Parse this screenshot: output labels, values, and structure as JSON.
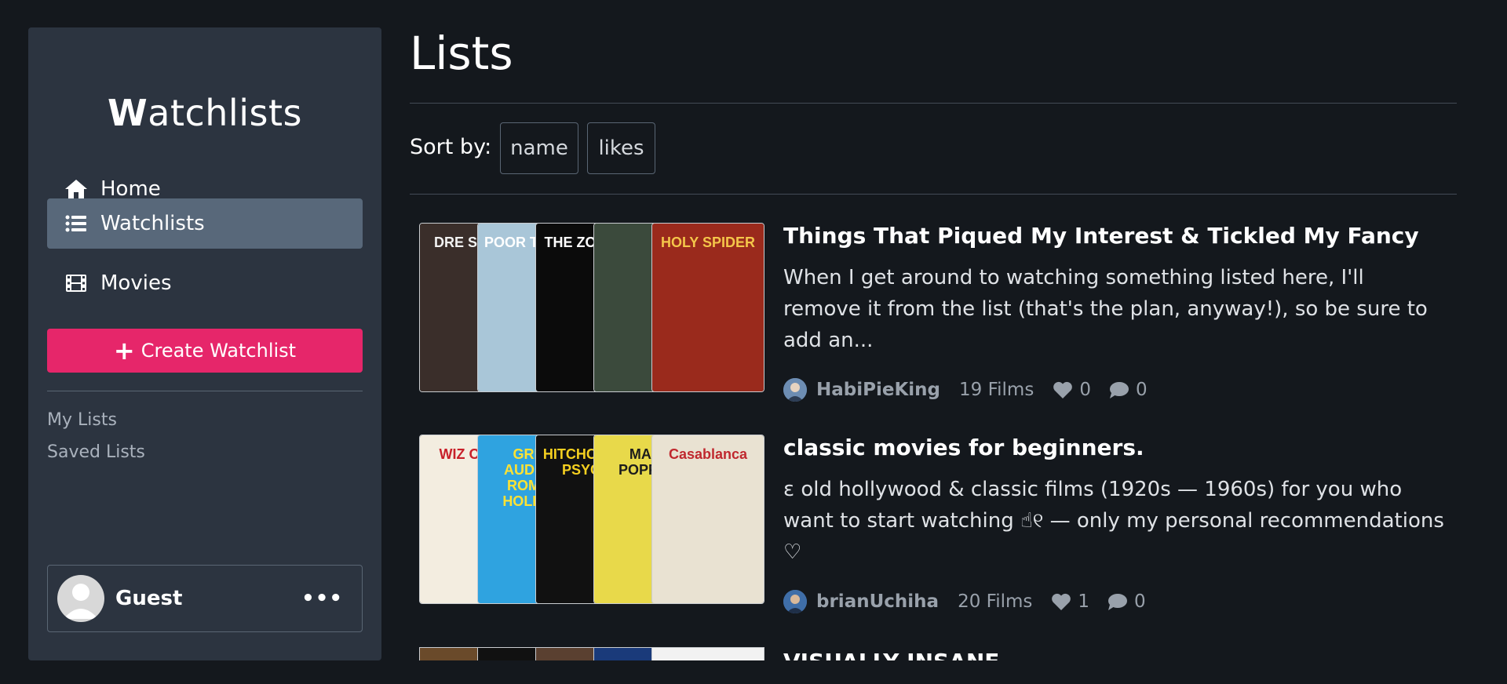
{
  "sidebar": {
    "brand_bold": "W",
    "brand_rest": "atchlists",
    "nav": [
      {
        "label": "Home",
        "icon": "home-icon"
      },
      {
        "label": "Watchlists",
        "icon": "list-icon"
      },
      {
        "label": "Movies",
        "icon": "film-icon"
      }
    ],
    "create_label": "Create Watchlist",
    "links": [
      "My Lists",
      "Saved Lists"
    ],
    "user": {
      "name": "Guest",
      "more": "•••"
    }
  },
  "main": {
    "title": "Lists",
    "sort_label": "Sort by:",
    "sort_options": [
      "name",
      "likes"
    ],
    "lists": [
      {
        "title": "Things That Piqued My Interest & Tickled My Fancy",
        "description": "When I get around to watching something listed here, I'll remove it from the list (that's the plan, anyway!), so be sure to add an...",
        "owner": "HabiPieKing",
        "films": "19 Films",
        "likes": "0",
        "comments": "0",
        "posters": [
          {
            "text": "DRE SCENA",
            "bg": "#3a2e2a",
            "fg": "#f2f2f2"
          },
          {
            "text": "POOR THINGS",
            "bg": "#a9c6d8",
            "fg": "#ffffff"
          },
          {
            "text": "THE ZONE OF",
            "bg": "#0b0b0b",
            "fg": "#ffffff"
          },
          {
            "text": "",
            "bg": "#3b4a3c",
            "fg": "#ffffff"
          },
          {
            "text": "HOLY SPIDER",
            "bg": "#9a2a1c",
            "fg": "#f4c64a"
          }
        ]
      },
      {
        "title": "classic movies for beginners.",
        "description": "ɛ old hollywood & classic films (1920s — 1960s) for you who want to start watching ☝︎୧ — only my personal recommendations ♡",
        "owner": "brianUchiha",
        "films": "20 Films",
        "likes": "1",
        "comments": "0",
        "posters": [
          {
            "text": "WIZ OF OZ",
            "bg": "#f3ede0",
            "fg": "#c8202a"
          },
          {
            "text": "GREG AUDREY ROMAN HOLIDAY",
            "bg": "#2fa3e0",
            "fg": "#ffe233"
          },
          {
            "text": "HITCHCOCK'S PSYCHO",
            "bg": "#111111",
            "fg": "#f5d020"
          },
          {
            "text": "MARY POPPINS",
            "bg": "#e8d94a",
            "fg": "#1c1c1c"
          },
          {
            "text": "Casablanca",
            "bg": "#e9e2d2",
            "fg": "#c0282e"
          }
        ]
      }
    ],
    "partial_title": "VISUALLY INSANE"
  },
  "colors": {
    "accent": "#e6266a",
    "sidebar_bg": "#2c3440",
    "page_bg": "#14181d",
    "active_nav": "#58687a"
  }
}
